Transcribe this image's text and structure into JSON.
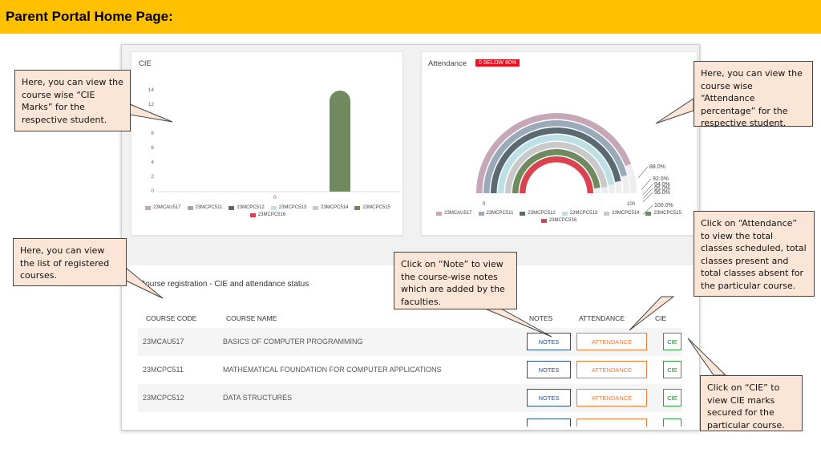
{
  "slide_title": "Parent Portal Home Page:",
  "cie_card": {
    "title": "CIE",
    "y_ticks": [
      "0",
      "2",
      "4",
      "6",
      "8",
      "12",
      "14"
    ],
    "x_tick": "0",
    "legend": [
      {
        "label": "23MCAU517",
        "color": "#c5a7b7"
      },
      {
        "label": "23MCPC511",
        "color": "#9aaabb"
      },
      {
        "label": "23MCPC512",
        "color": "#5a6a72"
      },
      {
        "label": "23MCPC513",
        "color": "#bde0e6"
      },
      {
        "label": "23MCPC514",
        "color": "#c9c9c9"
      },
      {
        "label": "23MCPC515",
        "color": "#6f8a5f"
      },
      {
        "label": "23MCPC516",
        "color": "#d9434f"
      }
    ]
  },
  "attendance_card": {
    "title": "Attendance",
    "badge": "0 BELOW 80%",
    "axis_min": "0",
    "axis_max": "100",
    "percent_labels": [
      "88.0%",
      "92.0%",
      "94.0%",
      "95.0%",
      "96.0%",
      "100.0%"
    ],
    "legend": [
      {
        "label": "23MCAU517",
        "color": "#c5a7b7"
      },
      {
        "label": "23MCPC511",
        "color": "#9aaabb"
      },
      {
        "label": "23MCPC512",
        "color": "#5a6a72"
      },
      {
        "label": "23MCPC513",
        "color": "#bde0e6"
      },
      {
        "label": "23MCPC514",
        "color": "#c9c9c9"
      },
      {
        "label": "23MCPC515",
        "color": "#6f8a5f"
      },
      {
        "label": "23MCPC516",
        "color": "#d9434f"
      }
    ]
  },
  "course_section": {
    "title": "Course registration - CIE and attendance status",
    "headers": {
      "code": "COURSE CODE",
      "name": "COURSE NAME",
      "notes": "NOTES",
      "attendance": "ATTENDANCE",
      "cie": "CIE"
    },
    "rows": [
      {
        "code": "23MCAU517",
        "name": "BASICS OF COMPUTER PROGRAMMING",
        "notes": "NOTES",
        "attendance": "ATTENDANCE",
        "cie": "CIE"
      },
      {
        "code": "23MCPC511",
        "name": "MATHEMATICAL FOUNDATION FOR COMPUTER APPLICATIONS",
        "notes": "NOTES",
        "attendance": "ATTENDANCE",
        "cie": "CIE"
      },
      {
        "code": "23MCPC512",
        "name": "DATA STRUCTURES",
        "notes": "NOTES",
        "attendance": "ATTENDANCE",
        "cie": "CIE"
      }
    ]
  },
  "callouts": {
    "cie_marks": "Here, you can view the course wise “CIE Marks” for the respective student.",
    "attendance_pct": "Here, you can view the course wise “Attendance percentage” for the respective student.",
    "registered": "Here, you can view the list of registered courses.",
    "note": "Click on “Note” to view the course-wise notes which are added by the faculties.",
    "attendance_click": "Click on “Attendance” to view the total classes scheduled, total classes present and total classes absent for the particular course.",
    "cie_click": "Click on “CIE” to view CIE marks secured for the particular course."
  },
  "chart_data": [
    {
      "type": "bar",
      "title": "CIE",
      "ylim": [
        0,
        15
      ],
      "categories": [
        "0"
      ],
      "series": [
        {
          "name": "23MCAU517",
          "values": [
            null
          ]
        },
        {
          "name": "23MCPC511",
          "values": [
            null
          ]
        },
        {
          "name": "23MCPC512",
          "values": [
            null
          ]
        },
        {
          "name": "23MCPC513",
          "values": [
            null
          ]
        },
        {
          "name": "23MCPC514",
          "values": [
            null
          ]
        },
        {
          "name": "23MCPC515",
          "values": [
            14
          ]
        },
        {
          "name": "23MCPC516",
          "values": [
            null
          ]
        }
      ]
    },
    {
      "type": "pie",
      "title": "Attendance",
      "series": [
        {
          "name": "23MCAU517",
          "values": [
            88.0
          ]
        },
        {
          "name": "23MCPC511",
          "values": [
            92.0
          ]
        },
        {
          "name": "23MCPC512",
          "values": [
            94.0
          ]
        },
        {
          "name": "23MCPC513",
          "values": [
            95.0
          ]
        },
        {
          "name": "23MCPC514",
          "values": [
            96.0
          ]
        },
        {
          "name": "23MCPC515",
          "values": [
            96.0
          ]
        },
        {
          "name": "23MCPC516",
          "values": [
            100.0
          ]
        }
      ]
    }
  ]
}
